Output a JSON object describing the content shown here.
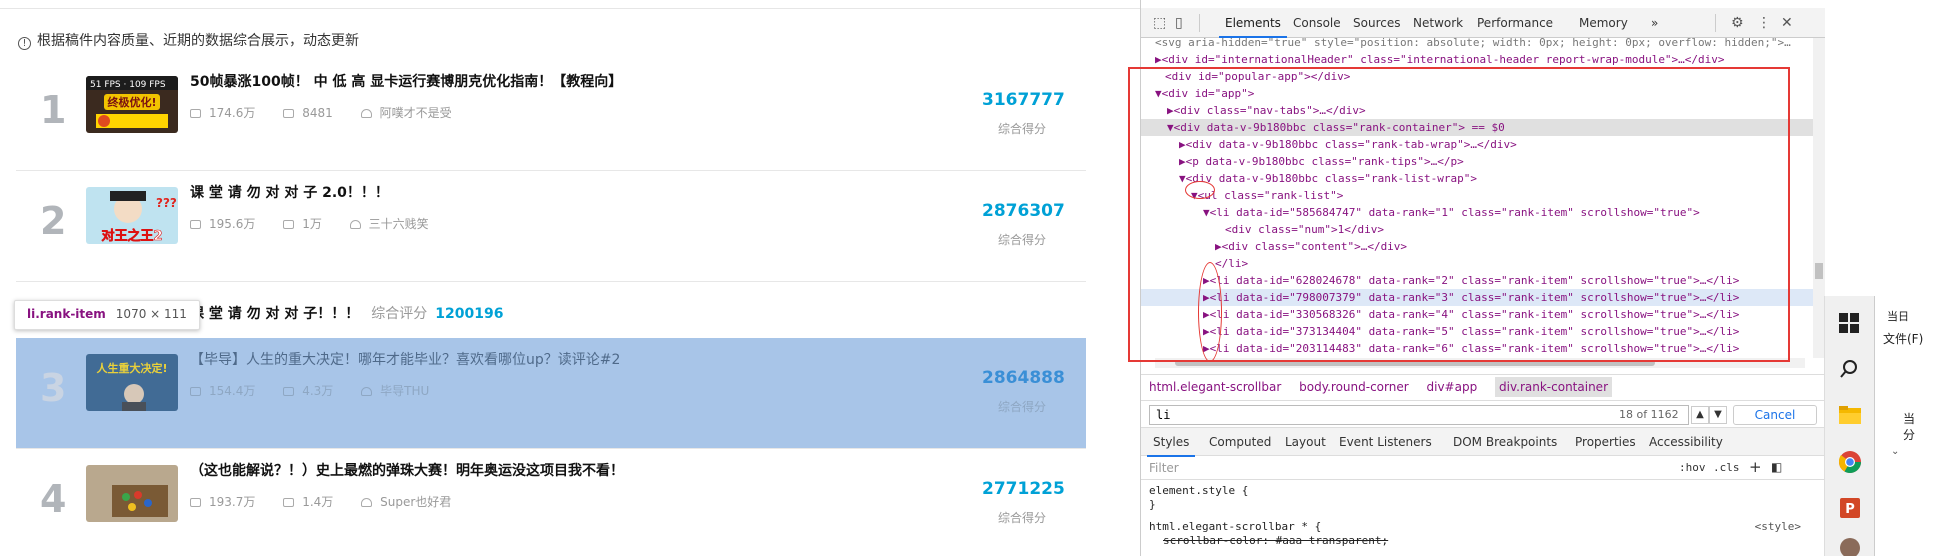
{
  "tips": {
    "icon": "info-icon",
    "text": "根据稿件内容质量、近期的数据综合展示，动态更新"
  },
  "rank_items": [
    {
      "rank": "1",
      "title": "50帧暴涨100帧！ 中 低 高 显卡运行赛博朋克优化指南！【教程向】",
      "views": "174.6万",
      "comments": "8481",
      "author": "阿噗才不是受",
      "score": "3167777",
      "score_label": "综合得分",
      "thumb_text": "终极优化!"
    },
    {
      "rank": "2",
      "title": "课 堂 请 勿 对 对 子 2.0！！！",
      "views": "195.6万",
      "comments": "1万",
      "author": "三十六贱笑",
      "score": "2876307",
      "score_label": "综合得分",
      "thumb_text": "对王之王2"
    },
    {
      "rank": "3",
      "title": "【毕导】人生的重大决定！哪年才能毕业？喜欢看哪位up？读评论#2",
      "views": "154.4万",
      "comments": "4.3万",
      "author": "毕导THU",
      "score": "2864888",
      "score_label": "综合得分",
      "thumb_text": "人生重大决定!"
    },
    {
      "rank": "4",
      "title": "（这也能解说？！）史上最燃的弹珠大赛！明年奥运没这项目我不看！",
      "views": "193.7万",
      "comments": "1.4万",
      "author": "Super也好君",
      "score": "2771225",
      "score_label": "综合得分",
      "thumb_text": ""
    }
  ],
  "floating_row": {
    "title": "课 堂 请 勿 对 对 子！！！",
    "label": "综合评分",
    "value": "1200196"
  },
  "tooltip": {
    "name": "li.rank-item",
    "size": "1070 × 111"
  },
  "devtools": {
    "tabs": [
      "Elements",
      "Console",
      "Sources",
      "Network",
      "Performance",
      "Memory",
      "»"
    ],
    "dom_lines": [
      {
        "text": "<svg aria-hidden=\"true\" style=\"position: absolute; width: 0px; height: 0px; overflow: hidden;\">…"
      },
      {
        "text": "▶<div id=\"internationalHeader\" class=\"international-header report-wrap-module\">…</div>"
      },
      {
        "text": "<div id=\"popular-app\"></div>"
      },
      {
        "text": "▼<div id=\"app\">"
      },
      {
        "text": "▶<div class=\"nav-tabs\">…</div>"
      },
      {
        "text": "▼<div data-v-9b180bbc class=\"rank-container\"> == $0"
      },
      {
        "text": "▶<div data-v-9b180bbc class=\"rank-tab-wrap\">…</div>"
      },
      {
        "text": "▶<p data-v-9b180bbc class=\"rank-tips\">…</p>"
      },
      {
        "text": "▼<div data-v-9b180bbc class=\"rank-list-wrap\">"
      },
      {
        "text": "▼<ul class=\"rank-list\">"
      },
      {
        "text": "▼<li data-id=\"585684747\" data-rank=\"1\" class=\"rank-item\" scrollshow=\"true\">"
      },
      {
        "text": "<div class=\"num\">1</div>"
      },
      {
        "text": "▶<div class=\"content\">…</div>"
      },
      {
        "text": "</li>"
      },
      {
        "text": "▶<li data-id=\"628024678\" data-rank=\"2\" class=\"rank-item\" scrollshow=\"true\">…</li>"
      },
      {
        "text": "▶<li data-id=\"798007379\" data-rank=\"3\" class=\"rank-item\" scrollshow=\"true\">…</li>"
      },
      {
        "text": "▶<li data-id=\"330568326\" data-rank=\"4\" class=\"rank-item\" scrollshow=\"true\">…</li>"
      },
      {
        "text": "▶<li data-id=\"373134404\" data-rank=\"5\" class=\"rank-item\" scrollshow=\"true\">…</li>"
      },
      {
        "text": "▶<li data-id=\"203114483\" data-rank=\"6\" class=\"rank-item\" scrollshow=\"true\">…</li>"
      }
    ],
    "breadcrumbs": [
      "html.elegant-scrollbar",
      "body.round-corner",
      "div#app",
      "div.rank-container"
    ],
    "search": {
      "value": "li",
      "count": "18 of 1162",
      "cancel": "Cancel"
    },
    "subtabs": [
      "Styles",
      "Computed",
      "Layout",
      "Event Listeners",
      "DOM Breakpoints",
      "Properties",
      "Accessibility"
    ],
    "filter": {
      "placeholder": "Filter",
      "hov": ":hov",
      "cls": ".cls",
      "plus": "+"
    },
    "styles_rules": {
      "element_style": "element.style {",
      "close": "}",
      "rule_selector": "html.elegant-scrollbar * {",
      "rule_source": "<style>",
      "rule_prop": "scrollbar-color: #aaa transparent;"
    }
  },
  "right_panel": {
    "line1": "当日",
    "line2": "文件(F)",
    "line3": "当",
    "line4": "分"
  },
  "colors": {
    "accent": "#00a1d6",
    "highlight": "#a8c5e8",
    "red_box": "#e53935"
  }
}
